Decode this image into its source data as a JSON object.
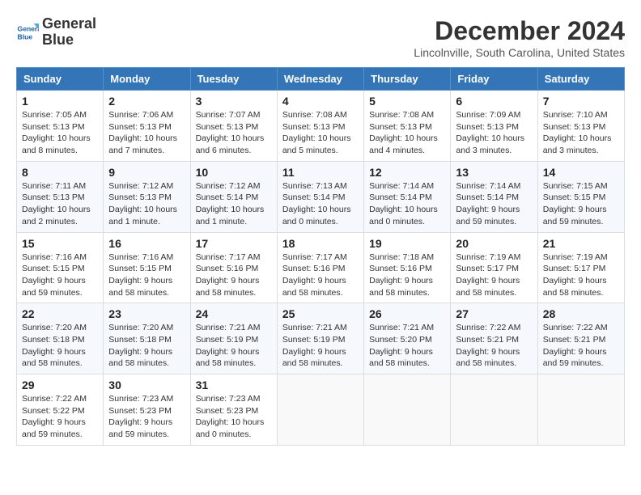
{
  "logo": {
    "line1": "General",
    "line2": "Blue"
  },
  "title": "December 2024",
  "location": "Lincolnville, South Carolina, United States",
  "days_of_week": [
    "Sunday",
    "Monday",
    "Tuesday",
    "Wednesday",
    "Thursday",
    "Friday",
    "Saturday"
  ],
  "weeks": [
    [
      {
        "day": "1",
        "sunrise": "Sunrise: 7:05 AM",
        "sunset": "Sunset: 5:13 PM",
        "daylight": "Daylight: 10 hours and 8 minutes."
      },
      {
        "day": "2",
        "sunrise": "Sunrise: 7:06 AM",
        "sunset": "Sunset: 5:13 PM",
        "daylight": "Daylight: 10 hours and 7 minutes."
      },
      {
        "day": "3",
        "sunrise": "Sunrise: 7:07 AM",
        "sunset": "Sunset: 5:13 PM",
        "daylight": "Daylight: 10 hours and 6 minutes."
      },
      {
        "day": "4",
        "sunrise": "Sunrise: 7:08 AM",
        "sunset": "Sunset: 5:13 PM",
        "daylight": "Daylight: 10 hours and 5 minutes."
      },
      {
        "day": "5",
        "sunrise": "Sunrise: 7:08 AM",
        "sunset": "Sunset: 5:13 PM",
        "daylight": "Daylight: 10 hours and 4 minutes."
      },
      {
        "day": "6",
        "sunrise": "Sunrise: 7:09 AM",
        "sunset": "Sunset: 5:13 PM",
        "daylight": "Daylight: 10 hours and 3 minutes."
      },
      {
        "day": "7",
        "sunrise": "Sunrise: 7:10 AM",
        "sunset": "Sunset: 5:13 PM",
        "daylight": "Daylight: 10 hours and 3 minutes."
      }
    ],
    [
      {
        "day": "8",
        "sunrise": "Sunrise: 7:11 AM",
        "sunset": "Sunset: 5:13 PM",
        "daylight": "Daylight: 10 hours and 2 minutes."
      },
      {
        "day": "9",
        "sunrise": "Sunrise: 7:12 AM",
        "sunset": "Sunset: 5:13 PM",
        "daylight": "Daylight: 10 hours and 1 minute."
      },
      {
        "day": "10",
        "sunrise": "Sunrise: 7:12 AM",
        "sunset": "Sunset: 5:14 PM",
        "daylight": "Daylight: 10 hours and 1 minute."
      },
      {
        "day": "11",
        "sunrise": "Sunrise: 7:13 AM",
        "sunset": "Sunset: 5:14 PM",
        "daylight": "Daylight: 10 hours and 0 minutes."
      },
      {
        "day": "12",
        "sunrise": "Sunrise: 7:14 AM",
        "sunset": "Sunset: 5:14 PM",
        "daylight": "Daylight: 10 hours and 0 minutes."
      },
      {
        "day": "13",
        "sunrise": "Sunrise: 7:14 AM",
        "sunset": "Sunset: 5:14 PM",
        "daylight": "Daylight: 9 hours and 59 minutes."
      },
      {
        "day": "14",
        "sunrise": "Sunrise: 7:15 AM",
        "sunset": "Sunset: 5:15 PM",
        "daylight": "Daylight: 9 hours and 59 minutes."
      }
    ],
    [
      {
        "day": "15",
        "sunrise": "Sunrise: 7:16 AM",
        "sunset": "Sunset: 5:15 PM",
        "daylight": "Daylight: 9 hours and 59 minutes."
      },
      {
        "day": "16",
        "sunrise": "Sunrise: 7:16 AM",
        "sunset": "Sunset: 5:15 PM",
        "daylight": "Daylight: 9 hours and 58 minutes."
      },
      {
        "day": "17",
        "sunrise": "Sunrise: 7:17 AM",
        "sunset": "Sunset: 5:16 PM",
        "daylight": "Daylight: 9 hours and 58 minutes."
      },
      {
        "day": "18",
        "sunrise": "Sunrise: 7:17 AM",
        "sunset": "Sunset: 5:16 PM",
        "daylight": "Daylight: 9 hours and 58 minutes."
      },
      {
        "day": "19",
        "sunrise": "Sunrise: 7:18 AM",
        "sunset": "Sunset: 5:16 PM",
        "daylight": "Daylight: 9 hours and 58 minutes."
      },
      {
        "day": "20",
        "sunrise": "Sunrise: 7:19 AM",
        "sunset": "Sunset: 5:17 PM",
        "daylight": "Daylight: 9 hours and 58 minutes."
      },
      {
        "day": "21",
        "sunrise": "Sunrise: 7:19 AM",
        "sunset": "Sunset: 5:17 PM",
        "daylight": "Daylight: 9 hours and 58 minutes."
      }
    ],
    [
      {
        "day": "22",
        "sunrise": "Sunrise: 7:20 AM",
        "sunset": "Sunset: 5:18 PM",
        "daylight": "Daylight: 9 hours and 58 minutes."
      },
      {
        "day": "23",
        "sunrise": "Sunrise: 7:20 AM",
        "sunset": "Sunset: 5:18 PM",
        "daylight": "Daylight: 9 hours and 58 minutes."
      },
      {
        "day": "24",
        "sunrise": "Sunrise: 7:21 AM",
        "sunset": "Sunset: 5:19 PM",
        "daylight": "Daylight: 9 hours and 58 minutes."
      },
      {
        "day": "25",
        "sunrise": "Sunrise: 7:21 AM",
        "sunset": "Sunset: 5:19 PM",
        "daylight": "Daylight: 9 hours and 58 minutes."
      },
      {
        "day": "26",
        "sunrise": "Sunrise: 7:21 AM",
        "sunset": "Sunset: 5:20 PM",
        "daylight": "Daylight: 9 hours and 58 minutes."
      },
      {
        "day": "27",
        "sunrise": "Sunrise: 7:22 AM",
        "sunset": "Sunset: 5:21 PM",
        "daylight": "Daylight: 9 hours and 58 minutes."
      },
      {
        "day": "28",
        "sunrise": "Sunrise: 7:22 AM",
        "sunset": "Sunset: 5:21 PM",
        "daylight": "Daylight: 9 hours and 59 minutes."
      }
    ],
    [
      {
        "day": "29",
        "sunrise": "Sunrise: 7:22 AM",
        "sunset": "Sunset: 5:22 PM",
        "daylight": "Daylight: 9 hours and 59 minutes."
      },
      {
        "day": "30",
        "sunrise": "Sunrise: 7:23 AM",
        "sunset": "Sunset: 5:23 PM",
        "daylight": "Daylight: 9 hours and 59 minutes."
      },
      {
        "day": "31",
        "sunrise": "Sunrise: 7:23 AM",
        "sunset": "Sunset: 5:23 PM",
        "daylight": "Daylight: 10 hours and 0 minutes."
      },
      null,
      null,
      null,
      null
    ]
  ]
}
